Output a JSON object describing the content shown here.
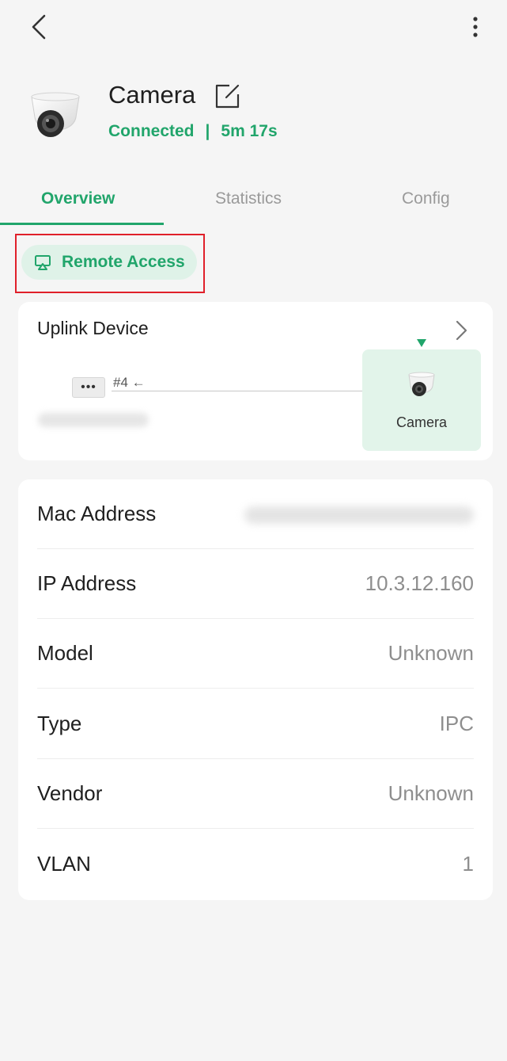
{
  "colors": {
    "accent": "#21a56b",
    "highlight": "#e0202a"
  },
  "header": {
    "back_icon": "chevron-left-icon",
    "more_icon": "more-vertical-icon"
  },
  "device": {
    "name": "Camera",
    "edit_icon": "edit-icon",
    "status": "Connected",
    "separator": "|",
    "uptime": "5m 17s"
  },
  "tabs": [
    {
      "label": "Overview",
      "active": true
    },
    {
      "label": "Statistics",
      "active": false
    },
    {
      "label": "Config",
      "active": false
    }
  ],
  "remote_access": {
    "label": "Remote Access",
    "icon": "screen-cast-icon"
  },
  "uplink": {
    "title": "Uplink Device",
    "port": "#4 ←",
    "switch_label": "•••",
    "current_device_label": "Camera"
  },
  "info": [
    {
      "key": "Mac Address",
      "value": ""
    },
    {
      "key": "IP Address",
      "value": "10.3.12.160"
    },
    {
      "key": "Model",
      "value": "Unknown"
    },
    {
      "key": "Type",
      "value": "IPC"
    },
    {
      "key": "Vendor",
      "value": "Unknown"
    },
    {
      "key": "VLAN",
      "value": "1"
    }
  ]
}
